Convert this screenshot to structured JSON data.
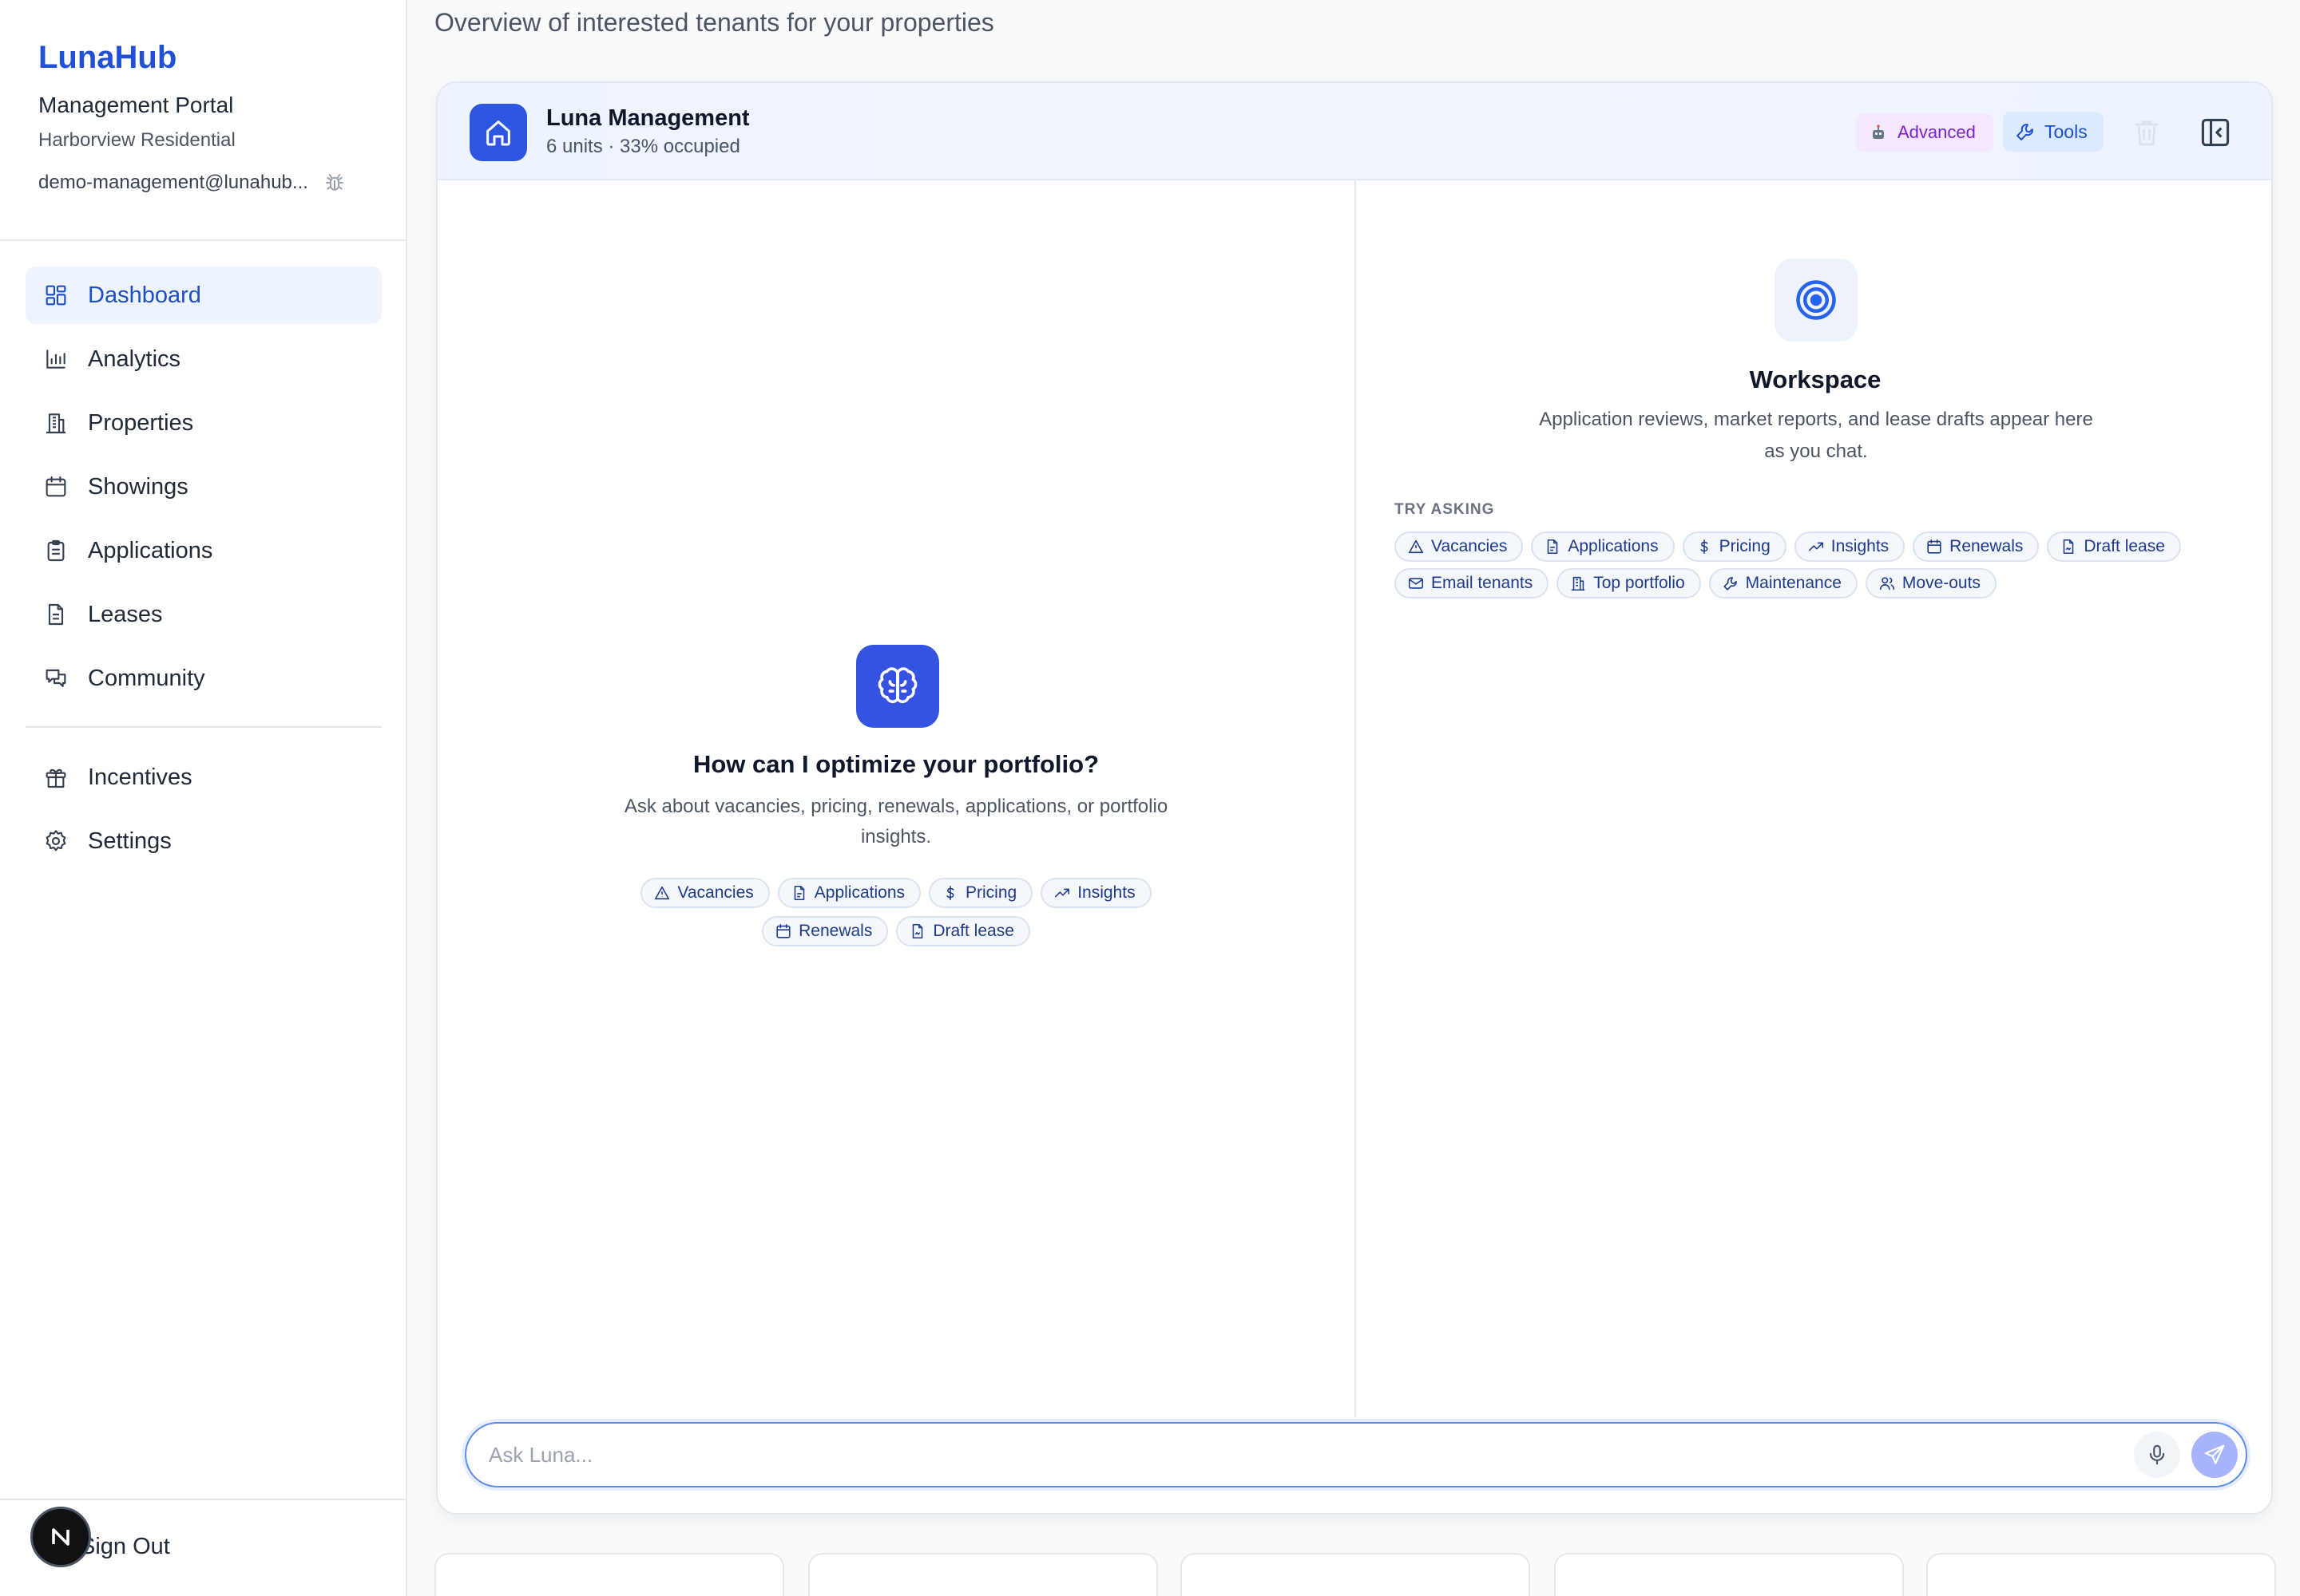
{
  "sidebar": {
    "brand": "LunaHub",
    "portal": "Management Portal",
    "company": "Harborview Residential",
    "email": "demo-management@lunahub...",
    "nav": [
      {
        "label": "Dashboard",
        "icon": "dashboard-icon",
        "active": true
      },
      {
        "label": "Analytics",
        "icon": "bar-chart-icon"
      },
      {
        "label": "Properties",
        "icon": "building-icon"
      },
      {
        "label": "Showings",
        "icon": "calendar-icon"
      },
      {
        "label": "Applications",
        "icon": "clipboard-icon"
      },
      {
        "label": "Leases",
        "icon": "document-icon"
      },
      {
        "label": "Community",
        "icon": "chat-icon"
      }
    ],
    "nav_secondary": [
      {
        "label": "Incentives",
        "icon": "gift-icon"
      },
      {
        "label": "Settings",
        "icon": "gear-icon"
      }
    ],
    "signout": "Sign Out",
    "badge_letter": "N"
  },
  "main": {
    "subtitle": "Overview of interested tenants for your properties"
  },
  "assistant": {
    "name": "Luna Management",
    "meta": "6 units · 33% occupied",
    "advanced_label": "Advanced",
    "tools_label": "Tools",
    "hero_title": "How can I optimize your portfolio?",
    "hero_desc": "Ask about vacancies, pricing, renewals, applications, or portfolio insights.",
    "hero_chips": [
      "Vacancies",
      "Applications",
      "Pricing",
      "Insights",
      "Renewals",
      "Draft lease"
    ],
    "workspace_title": "Workspace",
    "workspace_desc": "Application reviews, market reports, and lease drafts appear here as you chat.",
    "try_label": "TRY ASKING",
    "workspace_chips": [
      "Vacancies",
      "Applications",
      "Pricing",
      "Insights",
      "Renewals",
      "Draft lease",
      "Email tenants",
      "Top portfolio",
      "Maintenance",
      "Move-outs"
    ],
    "input_placeholder": "Ask Luna...",
    "input_value": ""
  },
  "colors": {
    "brand": "#2150d6",
    "accent": "#2d56e0",
    "active_nav_bg": "#eef4ff",
    "advanced_bg": "#f3e8ff",
    "tools_bg": "#dbeafe"
  }
}
